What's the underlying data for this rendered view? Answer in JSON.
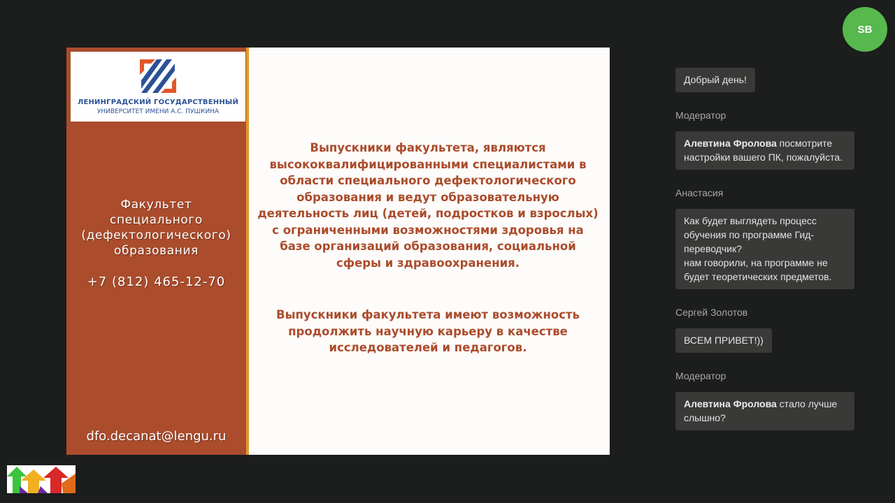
{
  "slide": {
    "university_line1": "ЛЕНИНГРАДСКИЙ ГОСУДАРСТВЕННЫЙ",
    "university_line2": "УНИВЕРСИТЕТ ИМЕНИ А.С. ПУШКИНА",
    "faculty_lines": [
      "Факультет",
      "специального",
      "(дефектологического)",
      "образования"
    ],
    "phone": "+7 (812) 465-12-70",
    "email": "dfo.decanat@lengu.ru",
    "paragraph1_lines": [
      "Выпускники  факультета, являются",
      "высококвалифицированными специалистами в",
      "области специального дефектологического",
      "образования и ведут образовательную",
      "деятельность лиц (детей, подростков и взрослых)",
      "с ограниченными возможностями здоровья на",
      "базе организаций образования, социальной",
      "сферы и здравоохранения."
    ],
    "paragraph2_lines": [
      "Выпускники факультета имеют возможность",
      "продолжить научную карьеру в качестве",
      "исследователей и педагогов."
    ]
  },
  "user": {
    "initials": "SB"
  },
  "chat": {
    "messages": [
      {
        "author": "",
        "mention": "",
        "text": "Добрый день!"
      },
      {
        "author": "Модератор",
        "mention": "Алевтина Фролова",
        "text": " посмотрите настройки вашего ПК, пожалуйста."
      },
      {
        "author": "Анастасия",
        "mention": "",
        "text": "Как будет выглядеть процесс обучения по программе Гид-переводчик?",
        "text2": "нам говорили, на программе не будет теоретических предметов."
      },
      {
        "author": "Сергей Золотов",
        "mention": "",
        "text": "ВСЕМ ПРИВЕТ!))"
      },
      {
        "author": "Модератор",
        "mention": "Алевтина Фролова",
        "text": " стало лучше слышно?"
      }
    ]
  },
  "colors": {
    "background": "#1c1d1d",
    "slide_accent": "#ab4c2c",
    "avatar": "#56b84d",
    "bubble": "#393938"
  }
}
